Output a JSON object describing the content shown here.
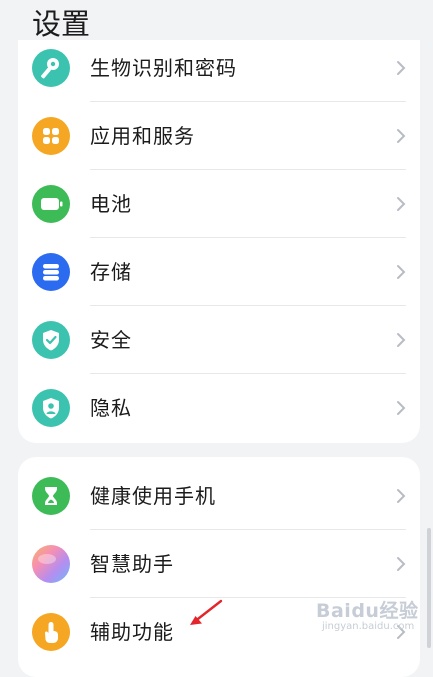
{
  "header": {
    "title": "设置"
  },
  "group1": {
    "items": [
      {
        "label": "生物识别和密码",
        "icon": "key-icon",
        "color": "#3cc3b0"
      },
      {
        "label": "应用和服务",
        "icon": "apps-grid-icon",
        "color": "#f5a623"
      },
      {
        "label": "电池",
        "icon": "battery-icon",
        "color": "#3dbb57"
      },
      {
        "label": "存储",
        "icon": "storage-icon",
        "color": "#2a6bf0"
      },
      {
        "label": "安全",
        "icon": "shield-check-icon",
        "color": "#3cc3b0"
      },
      {
        "label": "隐私",
        "icon": "privacy-shield-icon",
        "color": "#3cc3b0"
      }
    ]
  },
  "group2": {
    "items": [
      {
        "label": "健康使用手机",
        "icon": "hourglass-icon",
        "color": "#3dbb57"
      },
      {
        "label": "智慧助手",
        "icon": "assistant-orb-icon",
        "color": "#c68ef0"
      },
      {
        "label": "辅助功能",
        "icon": "hand-tap-icon",
        "color": "#f5a623"
      }
    ]
  },
  "annotation": {
    "arrow_color": "#e2262c"
  },
  "watermark": {
    "text": "Baidu经验",
    "sub": "jingyan.baidu.com"
  }
}
